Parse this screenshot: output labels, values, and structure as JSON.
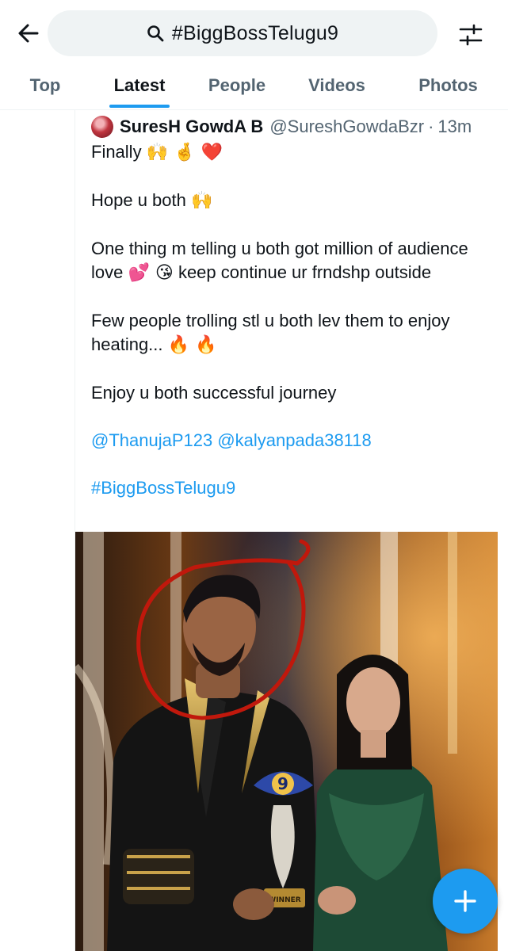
{
  "search": {
    "query": "#BiggBossTelugu9"
  },
  "tabs": [
    {
      "label": "Top",
      "active": false
    },
    {
      "label": "Latest",
      "active": true
    },
    {
      "label": "People",
      "active": false
    },
    {
      "label": "Videos",
      "active": false
    },
    {
      "label": "Photos",
      "active": false
    }
  ],
  "tweet": {
    "author_name": "SuresH GowdA B",
    "author_handle": "@SureshGowdaBzr",
    "separator": "·",
    "time": "13m",
    "lines": {
      "p1": "Finally",
      "p1_emoji": "🙌 🤞 ❤️",
      "p2": "Hope u both",
      "p2_emoji": "🙌",
      "p3a": "One thing m telling u both got million of audience love",
      "p3_emoji": "💕 😘",
      "p3b": "keep continue ur frndshp outside",
      "p4": "Few people trolling stl u both lev them to enjoy heating...",
      "p4_emoji": "🔥 🔥",
      "p5": "Enjoy u both successful journey"
    },
    "mentions": [
      "@ThanujaP123",
      "@kalyanpada38118"
    ],
    "hashtag": "#BiggBossTelugu9",
    "trophy_label": "WINNER"
  },
  "colors": {
    "accent": "#1d9bf0",
    "text_primary": "#0f1419",
    "text_secondary": "#536471",
    "search_bg": "#eff3f4",
    "annotation_circle": "#c0180c"
  },
  "icons": {
    "back": "arrow-left-icon",
    "search": "magnifier-icon",
    "filter": "sliders-icon",
    "compose": "plus-icon"
  }
}
